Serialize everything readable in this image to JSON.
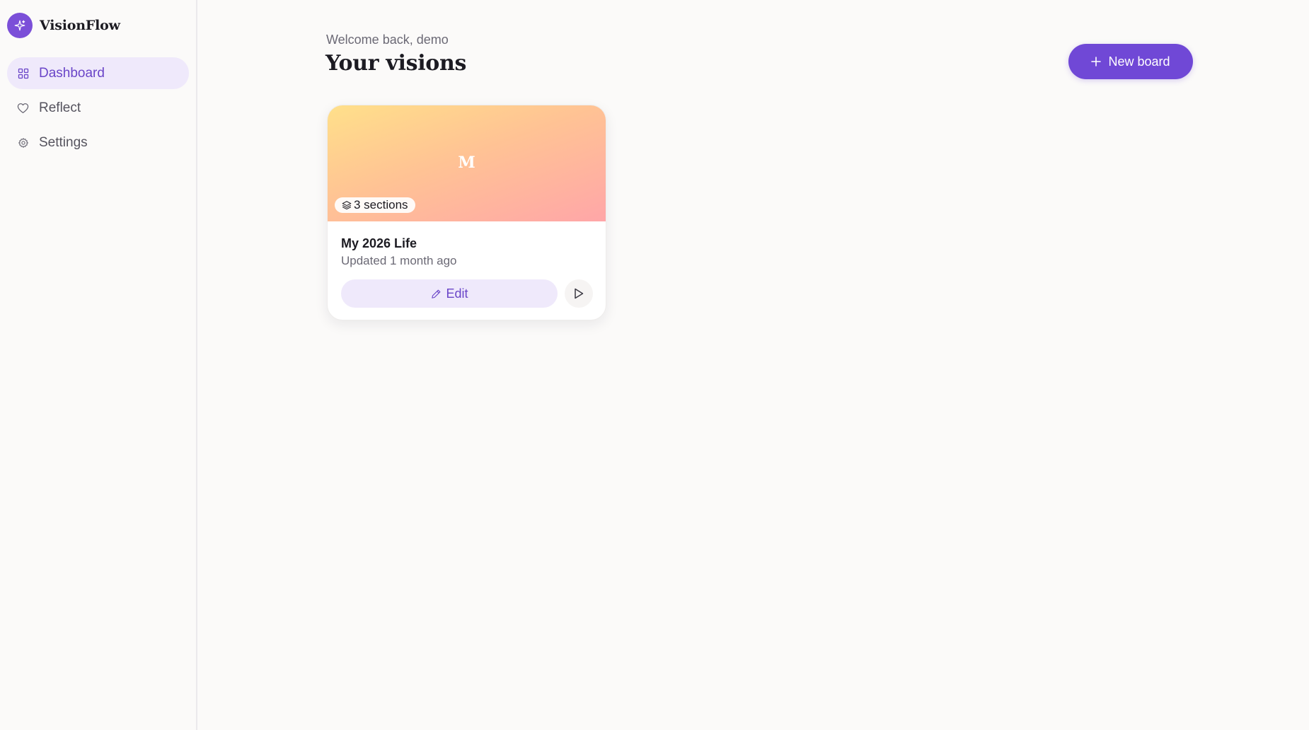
{
  "app": {
    "name": "VisionFlow"
  },
  "sidebar": {
    "items": [
      {
        "label": "Dashboard",
        "icon": "grid-icon",
        "active": true
      },
      {
        "label": "Reflect",
        "icon": "heart-icon",
        "active": false
      },
      {
        "label": "Settings",
        "icon": "gear-icon",
        "active": false
      }
    ]
  },
  "header": {
    "welcome": "Welcome back, demo",
    "title": "Your visions",
    "new_board_label": "New board"
  },
  "boards": [
    {
      "initial": "M",
      "sections": "3 sections",
      "title": "My 2026 Life",
      "updated": "Updated 1 month ago",
      "edit_label": "Edit"
    }
  ],
  "colors": {
    "accent": "#7048d6",
    "accent_soft": "#efe9fb",
    "background": "#fbfaf9"
  }
}
